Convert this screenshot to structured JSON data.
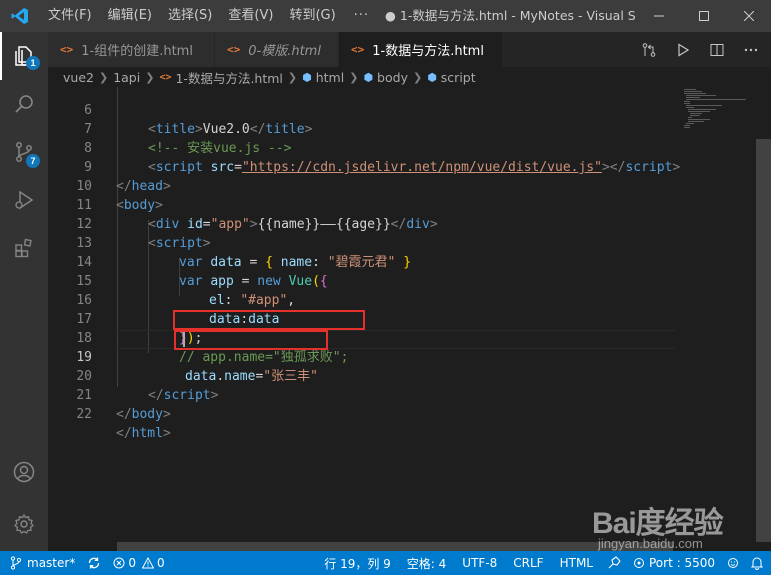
{
  "titlebar": {
    "menu": [
      "文件(F)",
      "编辑(E)",
      "选择(S)",
      "查看(V)",
      "转到(G)"
    ],
    "more": "···",
    "window_title": "● 1-数据与方法.html - MyNotes - Visual St..."
  },
  "activity": {
    "explorer_badge": "1",
    "scm_badge": "7"
  },
  "tabs": [
    {
      "label": "1-组件的创建.html",
      "icon": "<>"
    },
    {
      "label": "0-模版.html",
      "icon": "<>"
    },
    {
      "label": "1-数据与方法.html",
      "icon": "<>"
    }
  ],
  "breadcrumb": [
    "vue2",
    "1api",
    "1-数据与方法.html",
    "html",
    "body",
    "script"
  ],
  "editor": {
    "lines": [
      {
        "n": "6"
      },
      {
        "n": "7"
      },
      {
        "n": "8"
      },
      {
        "n": "9"
      },
      {
        "n": "10"
      },
      {
        "n": "11"
      },
      {
        "n": "12"
      },
      {
        "n": "13"
      },
      {
        "n": "14"
      },
      {
        "n": "15"
      },
      {
        "n": "16"
      },
      {
        "n": "17"
      },
      {
        "n": "18"
      },
      {
        "n": "19"
      },
      {
        "n": "20"
      },
      {
        "n": "21"
      },
      {
        "n": "22"
      }
    ],
    "code": {
      "l6_tag": "title",
      "l6_text": "Vue2.0",
      "l7_comment": "<!-- 安装vue.js -->",
      "l8_tag": "script",
      "l8_attr": "src",
      "l8_url": "\"https://cdn.jsdelivr.net/npm/vue/dist/vue.js\"",
      "l9_tag": "head",
      "l10_tag": "body",
      "l11_tag": "div",
      "l11_attr": "id",
      "l11_val": "\"app\"",
      "l11_text_a": "{{name}}",
      "l11_dash": "——",
      "l11_text_b": "{{age}}",
      "l12_tag": "script",
      "l13_kw": "var",
      "l13_var": "data",
      "l13_key": "name",
      "l13_val": "\"碧霞元君\"",
      "l14_kw": "var",
      "l14_var": "app",
      "l14_new": "new",
      "l14_cls": "Vue",
      "l15_key": "el",
      "l15_val": "\"#app\"",
      "l16_key": "data",
      "l16_val": "data",
      "l18_comment": "// app.name=\"独孤求败\";",
      "l19_obj": "data",
      "l19_prop": "name",
      "l19_val": "\"张三丰\"",
      "l20_tag": "script",
      "l21_tag": "body",
      "l22_tag": "html"
    }
  },
  "status": {
    "branch": "master*",
    "errors": "0",
    "warnings": "0",
    "position": "行 19，列 9",
    "spaces": "空格: 4",
    "encoding": "UTF-8",
    "eol": "CRLF",
    "language": "HTML",
    "port": "Port : 5500"
  },
  "watermark": {
    "logo": "Bai度经验",
    "sub": "jingyan.baidu.com"
  }
}
